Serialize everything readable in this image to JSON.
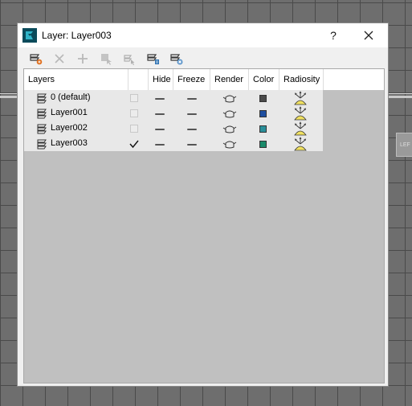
{
  "dialog": {
    "title": "Layer: Layer003",
    "help_label": "?",
    "close_icon": "close-icon"
  },
  "toolbar": {
    "buttons": [
      {
        "name": "create-layer-icon",
        "enabled": true
      },
      {
        "name": "delete-layer-icon",
        "enabled": false
      },
      {
        "name": "add-to-layer-icon",
        "enabled": false
      },
      {
        "name": "select-objects-icon",
        "enabled": false
      },
      {
        "name": "highlight-selected-icon",
        "enabled": false
      },
      {
        "name": "hide-all-layers-icon",
        "enabled": true
      },
      {
        "name": "freeze-all-layers-icon",
        "enabled": true
      }
    ]
  },
  "table": {
    "columns": [
      "Layers",
      "",
      "Hide",
      "Freeze",
      "Render",
      "Color",
      "Radiosity"
    ],
    "rows": [
      {
        "name": "0 (default)",
        "current": false,
        "color": "#4a4a4a"
      },
      {
        "name": "Layer001",
        "current": false,
        "color": "#1f4fa0"
      },
      {
        "name": "Layer002",
        "current": false,
        "color": "#2a8f9a"
      },
      {
        "name": "Layer003",
        "current": true,
        "color": "#1a8a6a"
      }
    ]
  },
  "background": {
    "viewport_label": "LEF"
  }
}
